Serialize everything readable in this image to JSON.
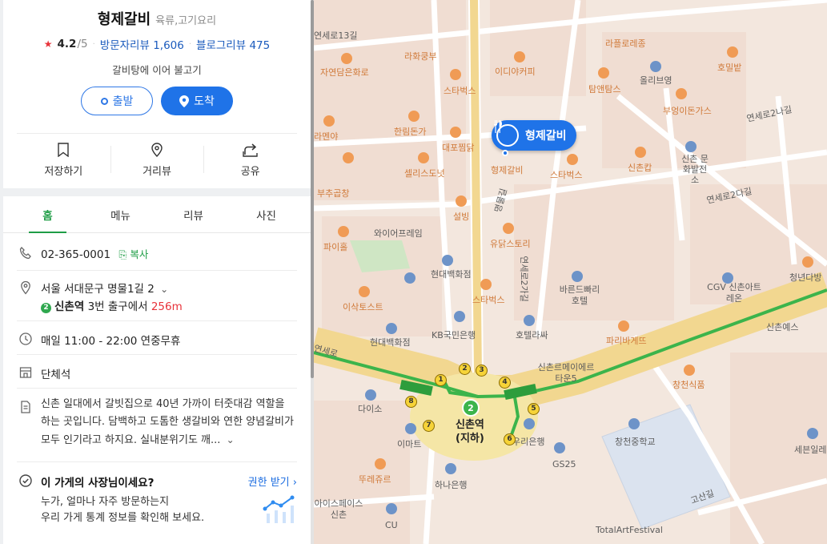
{
  "place": {
    "name": "형제갈비",
    "category": "육류,고기요리",
    "rating": "4.2",
    "rating_max": "/5",
    "visitor_reviews_label": "방문자리뷰",
    "visitor_reviews_count": "1,606",
    "blog_reviews_label": "블로그리뷰",
    "blog_reviews_count": "475",
    "tagline": "갈비탕에 이어 불고기"
  },
  "buttons": {
    "start": "출발",
    "arrive": "도착"
  },
  "actions": {
    "save": "저장하기",
    "street_view": "거리뷰",
    "share": "공유"
  },
  "tabs": [
    "홈",
    "메뉴",
    "리뷰",
    "사진"
  ],
  "info": {
    "phone": "02-365-0001",
    "copy_label": "복사",
    "address": "서울 서대문구 명물1길 2",
    "subway_line": "2",
    "station": "신촌역",
    "exit_text": "3번 출구에서",
    "distance": "256m",
    "hours": "매일 11:00 - 22:00 연중무휴",
    "facility": "단체석",
    "description": "신촌 일대에서 갈빗집으로 40년 가까이 터줏대감 역할을 하는 곳입니다. 담백하고 도톰한 생갈비와 연한 양념갈비가 모두 인기라고 하지요. 실내분위기도 깨...",
    "owner_question": "이 가게의 사장님이세요?",
    "owner_link": "권한 받기",
    "owner_desc_1": "누가, 얼마나 자주 방문하는지",
    "owner_desc_2": "우리 가게 통계 정보를 확인해 보세요."
  },
  "map": {
    "marker_label": "형제갈비",
    "station_label_1": "신촌역",
    "station_label_2": "(지하)",
    "line_number": "2",
    "colors": {
      "line2": "#3cb44b",
      "marker": "#1f73e8",
      "road_main": "#f4dca0",
      "poi": "#f09b55"
    },
    "labels": {
      "l1": "연세로13길",
      "l2": "라화쿵부",
      "l3": "자연담은화로",
      "l4": "이디야커피",
      "l5": "라플로레종",
      "l6": "호밀밭",
      "l7": "스타벅스",
      "l8": "탐앤탐스",
      "l9": "올리브영",
      "l10": "부엉이돈가스",
      "l11": "한림돈가",
      "l12": "라멘야",
      "l13": "대포찜닭",
      "l14": "셀리스도넛",
      "l15": "형제갈비",
      "l16": "스타벅스",
      "l17": "신촌캅",
      "l18": "신촌 문화발전소",
      "l19": "부추곱창",
      "l20": "설빙",
      "l21": "와이어프레임",
      "l22": "명물길",
      "l23": "유닭스토리",
      "l24": "파이홀",
      "l25": "현대백화점",
      "l26": "연세로2가길",
      "l27": "바른드빠리 호텔",
      "l28": "이삭토스트",
      "l29": "스타벅스",
      "l30": "CGV 신촌아트레온",
      "l31": "신촌예스",
      "l32": "KB국민은행",
      "l33": "호텔라싸",
      "l34": "파리바게뜨",
      "l35": "현대백화점",
      "l36": "신촌르메이에르 타운5",
      "l37": "창천식품",
      "l38": "다이소",
      "l39": "이마트",
      "l40": "우리은행",
      "l41": "GS25",
      "l42": "창천중학교",
      "l43": "세븐일레",
      "l44": "뚜레쥬르",
      "l45": "하나은행",
      "l46": "아이스페이스 신촌",
      "l47": "CU",
      "l48": "TotalArtFestival",
      "l49": "고산길",
      "l50": "연세로2나길",
      "l51": "연세로",
      "l52": "청년다방",
      "l53": "연세로2다길"
    }
  }
}
